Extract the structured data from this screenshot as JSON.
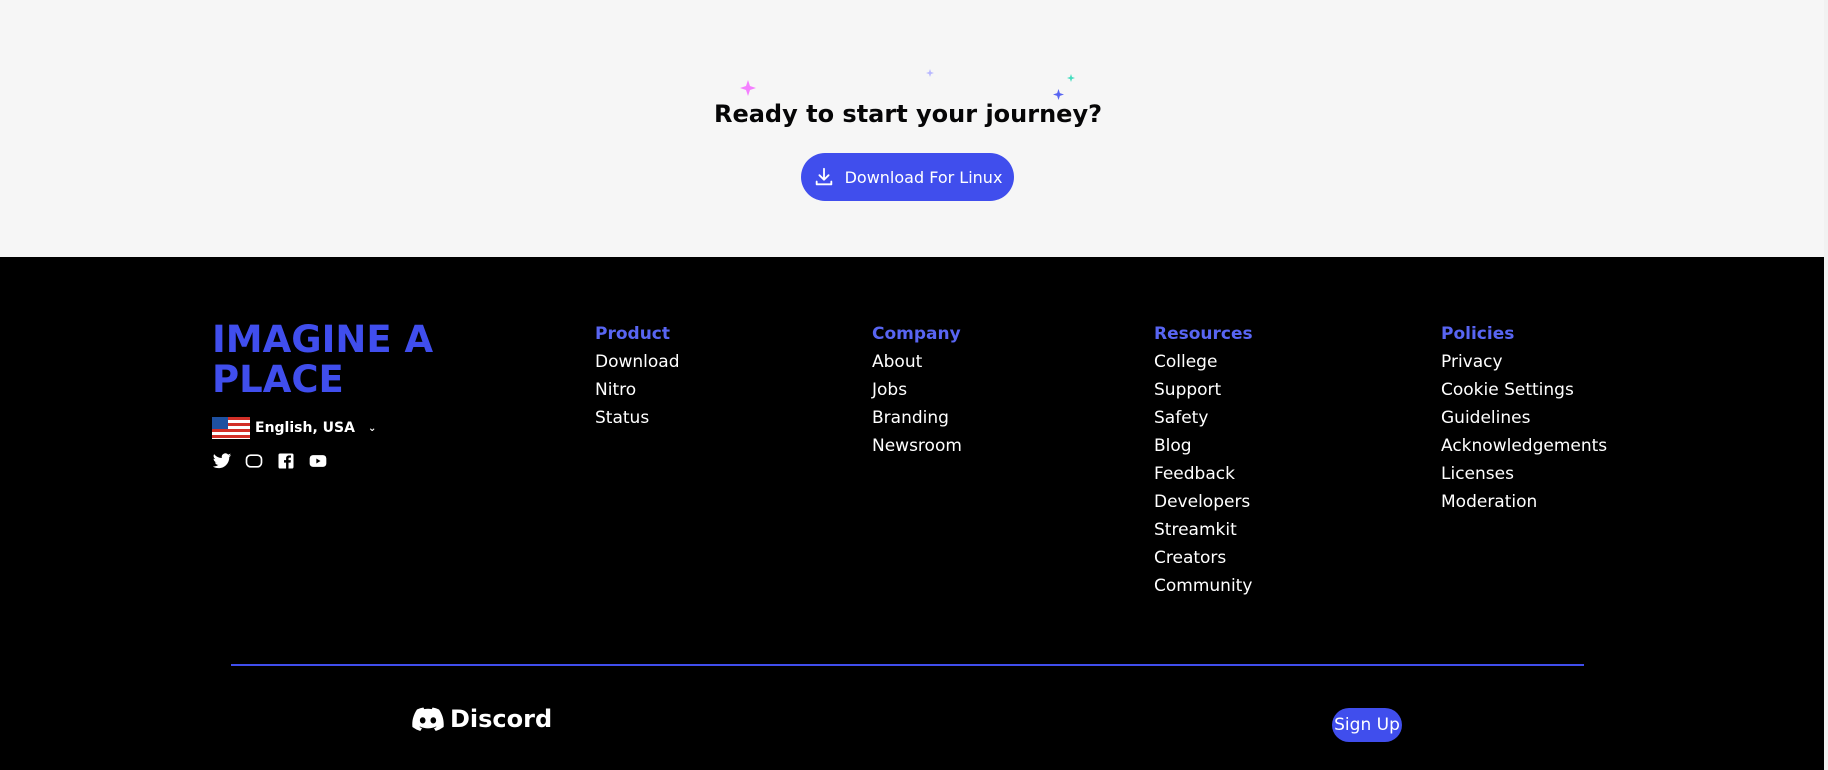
{
  "cta": {
    "title": "Ready to start your journey?",
    "download_label": "Download For Linux",
    "icon": "download-icon",
    "accent": "#404eed"
  },
  "footer": {
    "headline": "IMAGINE A PLACE",
    "language": "English, USA",
    "socials": [
      "twitter-icon",
      "instagram-icon",
      "facebook-icon",
      "youtube-icon"
    ],
    "columns": [
      {
        "title": "Product",
        "links": [
          "Download",
          "Nitro",
          "Status"
        ]
      },
      {
        "title": "Company",
        "links": [
          "About",
          "Jobs",
          "Branding",
          "Newsroom"
        ]
      },
      {
        "title": "Resources",
        "links": [
          "College",
          "Support",
          "Safety",
          "Blog",
          "Feedback",
          "Developers",
          "Streamkit",
          "Creators",
          "Community"
        ]
      },
      {
        "title": "Policies",
        "links": [
          "Privacy",
          "Cookie Settings",
          "Guidelines",
          "Acknowledgements",
          "Licenses",
          "Moderation"
        ]
      }
    ],
    "brand": "Discord",
    "signup_label": "Sign Up",
    "heading_color": "#5865f2",
    "divider_color": "#404eed"
  }
}
